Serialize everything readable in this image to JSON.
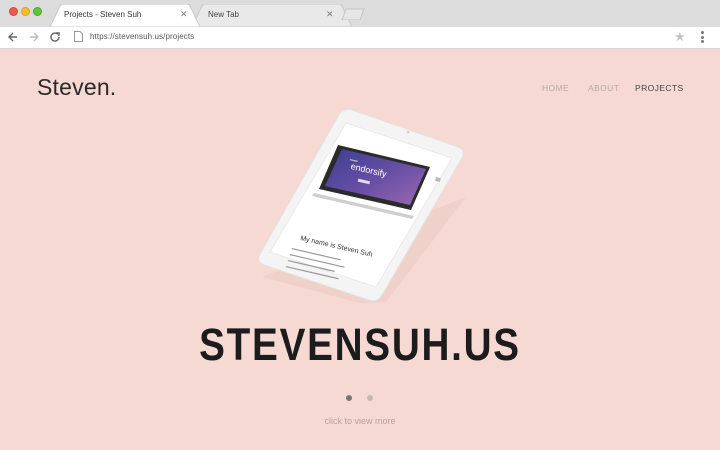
{
  "browser": {
    "tabs": [
      {
        "title": "Projects - Steven Suh",
        "close": "✕"
      },
      {
        "title": "New Tab",
        "close": "✕"
      }
    ],
    "url": "https://stevensuh.us/projects",
    "star": "★"
  },
  "site": {
    "logo": "Steven.",
    "nav": {
      "home": "HOME",
      "about": "ABOUT",
      "projects": "PROJECTS"
    },
    "slide": {
      "title": "STEVENSUH.US",
      "screen_brand": "endorsify",
      "screen_text": "My name is Steven Suh"
    },
    "more": "click to view more"
  },
  "colors": {
    "page_bg": "#f6d9d3",
    "title": "#1c1c1c",
    "nav_active": "#444444",
    "nav_inactive": "#b8a8a4"
  }
}
